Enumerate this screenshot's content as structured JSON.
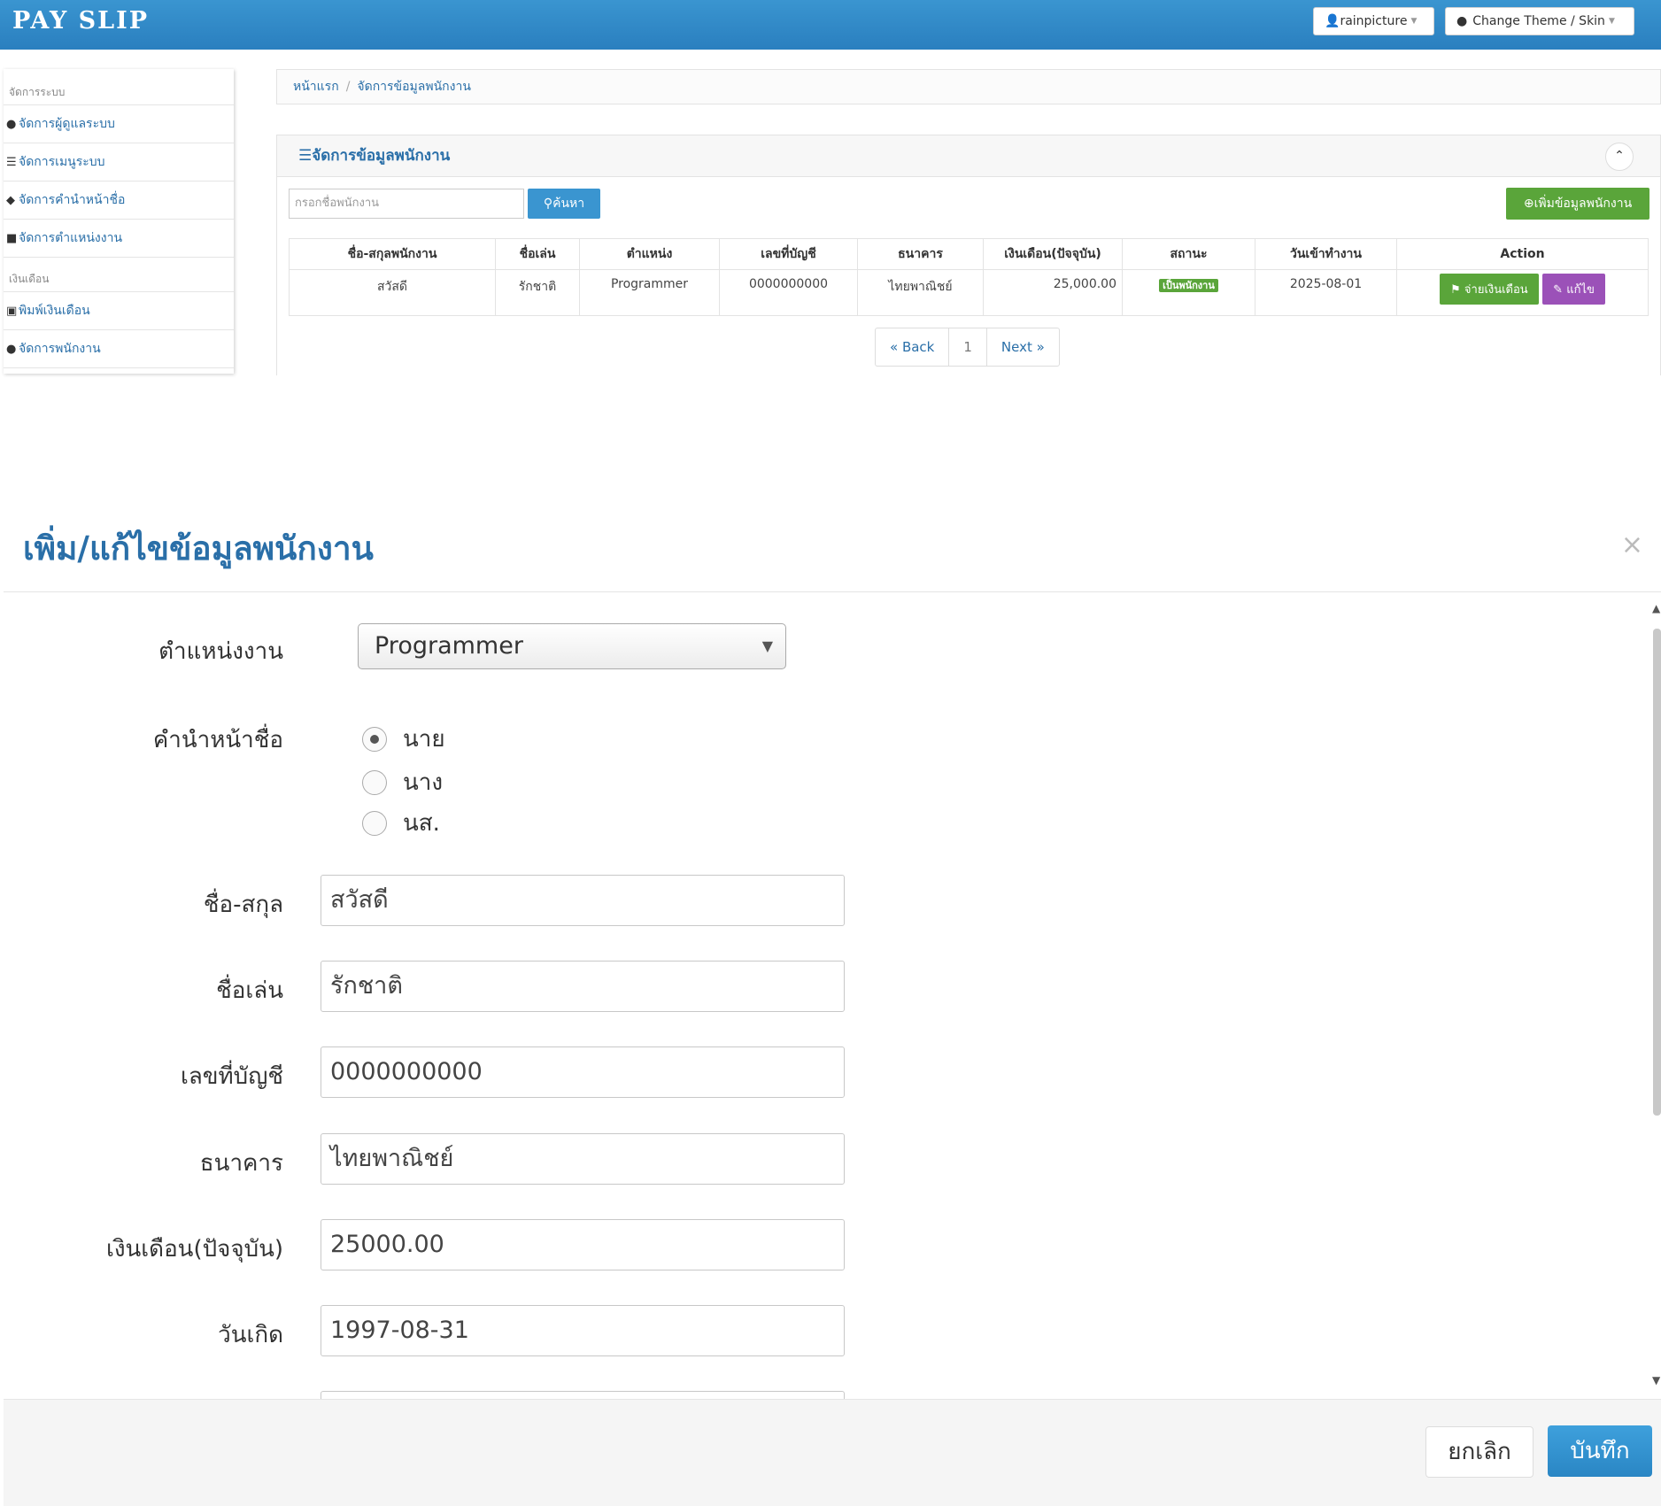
{
  "app": {
    "brand": "PAY SLIP"
  },
  "navbar": {
    "user_label": "rainpicture",
    "theme_label": "Change Theme / Skin"
  },
  "sidebar": {
    "sections": [
      {
        "heading": "จัดการระบบ",
        "items": [
          {
            "label": "จัดการผู้ดูแลระบบ",
            "icon": "user-icon"
          },
          {
            "label": "จัดการเมนูระบบ",
            "icon": "list-icon"
          },
          {
            "label": "จัดการคำนำหน้าชื่อ",
            "icon": "tag-icon"
          },
          {
            "label": "จัดการตำแหน่งงาน",
            "icon": "briefcase-icon"
          }
        ]
      },
      {
        "heading": "เงินเดือน",
        "items": [
          {
            "label": "พิมพ์เงินเดือน",
            "icon": "print-icon"
          },
          {
            "label": "จัดการพนักงาน",
            "icon": "user-icon"
          }
        ]
      }
    ]
  },
  "breadcrumb": {
    "home": "หน้าแรก",
    "current": "จัดการข้อมูลพนักงาน"
  },
  "panel": {
    "title": "จัดการข้อมูลพนักงาน",
    "search_placeholder": "กรอกชื่อพนักงาน",
    "search_button": "ค้นหา",
    "add_button": "เพิ่มข้อมูลพนักงาน"
  },
  "table": {
    "headers": [
      "ชื่อ-สกุลพนักงาน",
      "ชื่อเล่น",
      "ตำแหน่ง",
      "เลขที่บัญชี",
      "ธนาคาร",
      "เงินเดือน(ปัจจุบัน)",
      "สถานะ",
      "วันเข้าทำงาน",
      "Action"
    ],
    "rows": [
      {
        "name": "สวัสดี",
        "nickname": "รักชาติ",
        "position": "Programmer",
        "account": "0000000000",
        "bank": "ไทยพาณิชย์",
        "salary": "25,000.00",
        "status": "เป็นพนักงาน",
        "start_date": "2025-08-01",
        "pay_button": "จ่ายเงินเดือน",
        "edit_button": "แก้ไข"
      }
    ]
  },
  "pagination": {
    "back": "« Back",
    "current": "1",
    "next": "Next »"
  },
  "modal": {
    "title": "เพิ่ม/แก้ไขข้อมูลพนักงาน",
    "close": "×",
    "fields": {
      "position_label": "ตำแหน่งงาน",
      "position_value": "Programmer",
      "prefix_label": "คำนำหน้าชื่อ",
      "prefix_options": [
        "นาย",
        "นาง",
        "นส."
      ],
      "prefix_selected": "นาย",
      "name_label": "ชื่อ-สกุล",
      "name_value": "สวัสดี",
      "nickname_label": "ชื่อเล่น",
      "nickname_value": "รักชาติ",
      "account_label": "เลขที่บัญชี",
      "account_value": "0000000000",
      "bank_label": "ธนาคาร",
      "bank_value": "ไทยพาณิชย์",
      "salary_label": "เงินเดือน(ปัจจุบัน)",
      "salary_value": "25000.00",
      "birthday_label": "วันเกิด",
      "birthday_value": "1997-08-31"
    },
    "cancel_button": "ยกเลิก",
    "save_button": "บันทึก"
  },
  "colors": {
    "primary": "#2a7fbf",
    "success": "#5aa53a",
    "purple": "#9b51b8",
    "link": "#2a6fa8"
  }
}
